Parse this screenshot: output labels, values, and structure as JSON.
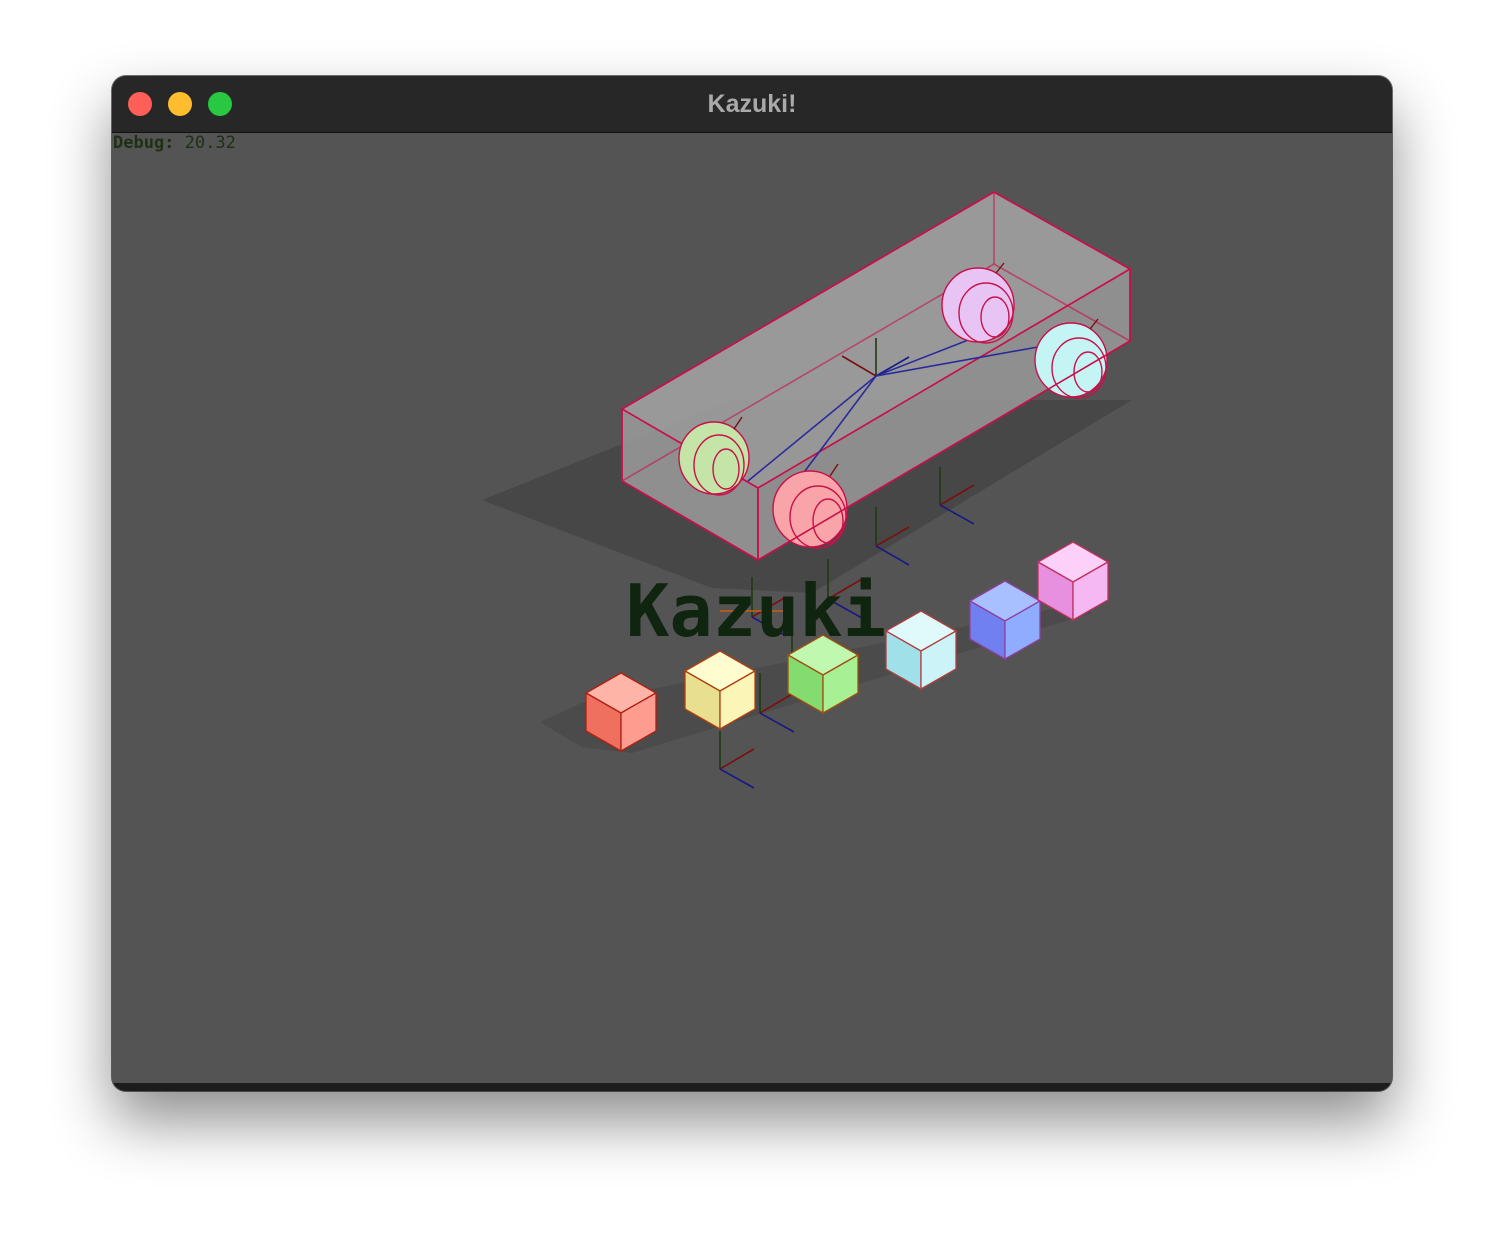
{
  "window": {
    "title": "Kazuki!"
  },
  "debug": {
    "label": "Debug:",
    "value": "20.32"
  },
  "scene": {
    "text_label": "Kazuki",
    "cube_colors": [
      "#ff8a80",
      "#f8f4a8",
      "#9ef08a",
      "#c4f4f8",
      "#8ea8ff",
      "#f4b4f0"
    ],
    "wheel_colors": [
      "#c4e4a8",
      "#f8a4a8",
      "#e8c4f4",
      "#c4f4f4"
    ]
  }
}
